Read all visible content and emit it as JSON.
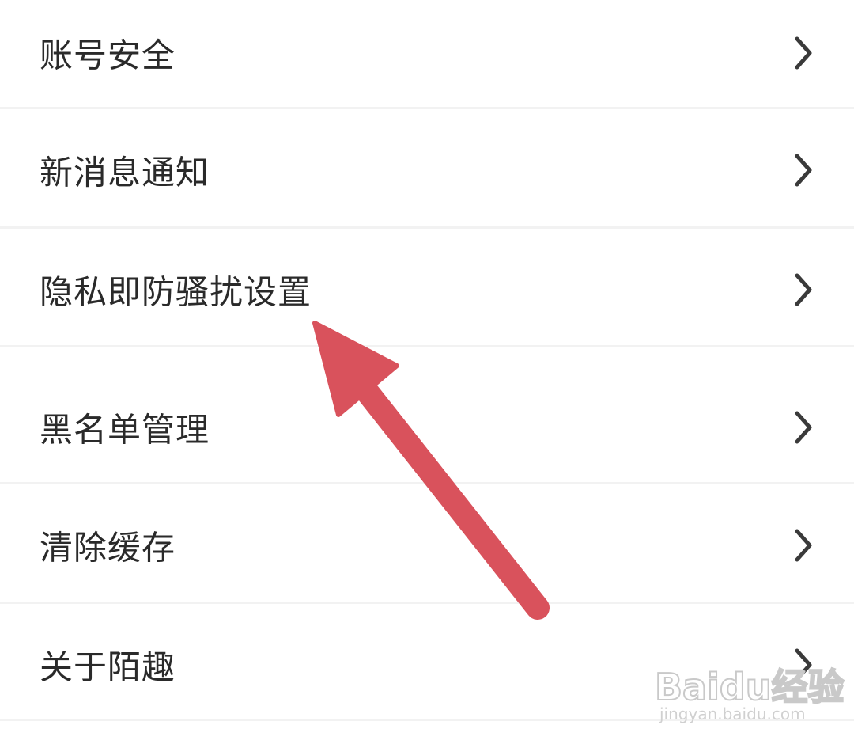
{
  "settings": {
    "items": [
      {
        "label": "账号安全",
        "icon": "chevron-right-icon"
      },
      {
        "label": "新消息通知",
        "icon": "chevron-right-icon"
      },
      {
        "label": "隐私即防骚扰设置",
        "icon": "chevron-right-icon"
      },
      {
        "label": "黑名单管理",
        "icon": "chevron-right-icon"
      },
      {
        "label": "清除缓存",
        "icon": "chevron-right-icon"
      },
      {
        "label": "关于陌趣",
        "icon": "chevron-right-icon"
      }
    ]
  },
  "annotation": {
    "arrow_color": "#d9525c",
    "points_to": "隐私即防骚扰设置"
  },
  "watermark": {
    "logo": "Baidu经验",
    "url": "jingyan.baidu.com"
  },
  "colors": {
    "text": "#2a2a2a",
    "chevron": "#3a3a3a",
    "divider": "#f2f2f2",
    "background": "#ffffff"
  }
}
